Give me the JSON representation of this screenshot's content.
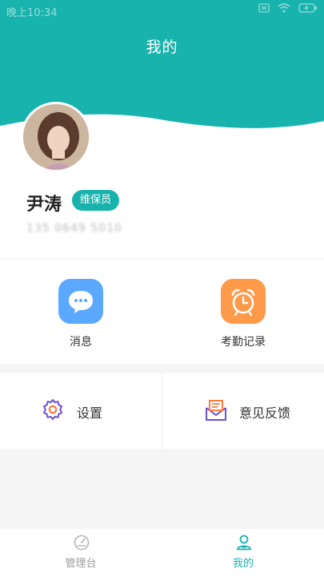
{
  "status_bar": {
    "time": "晚上10:34"
  },
  "header": {
    "title": "我的"
  },
  "profile": {
    "name": "尹涛",
    "role": "维保员",
    "phone": "135 0649 5010"
  },
  "quick_actions": [
    {
      "label": "消息",
      "icon": "chat-bubble-icon",
      "color": "#5aa8ff"
    },
    {
      "label": "考勤记录",
      "icon": "alarm-clock-icon",
      "color": "#ff9a4a"
    }
  ],
  "settings_row": [
    {
      "label": "设置",
      "icon": "gear-icon"
    },
    {
      "label": "意见反馈",
      "icon": "feedback-envelope-icon"
    }
  ],
  "tabbar": {
    "tabs": [
      {
        "label": "管理台",
        "icon": "dashboard-gauge-icon",
        "active": false
      },
      {
        "label": "我的",
        "icon": "user-profile-icon",
        "active": true
      }
    ]
  },
  "colors": {
    "accent": "#19b3ae",
    "inactive": "#9a9a9a"
  }
}
